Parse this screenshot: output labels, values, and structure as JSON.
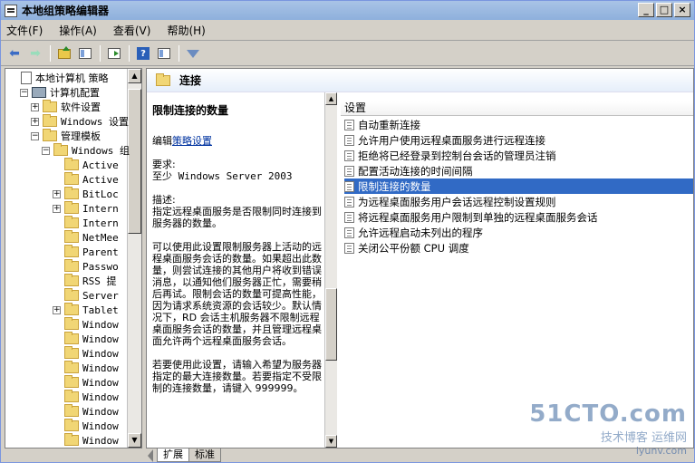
{
  "window": {
    "title": "本地组策略编辑器",
    "min": "_",
    "max": "□",
    "close": "×"
  },
  "menu": [
    "文件(F)",
    "操作(A)",
    "查看(V)",
    "帮助(H)"
  ],
  "tree": [
    {
      "label": "本地计算机 策略",
      "level": 0,
      "exp": "",
      "icon": "doc",
      "cn": true
    },
    {
      "label": "计算机配置",
      "level": 1,
      "exp": "−",
      "icon": "pc",
      "cn": true
    },
    {
      "label": "软件设置",
      "level": 2,
      "exp": "+",
      "icon": "folder",
      "cn": true
    },
    {
      "label": "Windows 设置",
      "level": 2,
      "exp": "+",
      "icon": "folder",
      "cn": false
    },
    {
      "label": "管理模板",
      "level": 2,
      "exp": "−",
      "icon": "folder",
      "cn": true
    },
    {
      "label": "Windows 组",
      "level": 3,
      "exp": "−",
      "icon": "folder",
      "cn": false
    },
    {
      "label": "Active",
      "level": 4,
      "exp": "",
      "icon": "folder",
      "cn": false
    },
    {
      "label": "Active",
      "level": 4,
      "exp": "",
      "icon": "folder",
      "cn": false
    },
    {
      "label": "BitLoc",
      "level": 4,
      "exp": "+",
      "icon": "folder",
      "cn": false
    },
    {
      "label": "Intern",
      "level": 4,
      "exp": "+",
      "icon": "folder",
      "cn": false
    },
    {
      "label": "Intern",
      "level": 4,
      "exp": "",
      "icon": "folder",
      "cn": false
    },
    {
      "label": "NetMee",
      "level": 4,
      "exp": "",
      "icon": "folder",
      "cn": false
    },
    {
      "label": "Parent",
      "level": 4,
      "exp": "",
      "icon": "folder",
      "cn": false
    },
    {
      "label": "Passwo",
      "level": 4,
      "exp": "",
      "icon": "folder",
      "cn": false
    },
    {
      "label": "RSS 提",
      "level": 4,
      "exp": "",
      "icon": "folder",
      "cn": false
    },
    {
      "label": "Server",
      "level": 4,
      "exp": "",
      "icon": "folder",
      "cn": false
    },
    {
      "label": "Tablet",
      "level": 4,
      "exp": "+",
      "icon": "folder",
      "cn": false
    },
    {
      "label": "Window",
      "level": 4,
      "exp": "",
      "icon": "folder",
      "cn": false
    },
    {
      "label": "Window",
      "level": 4,
      "exp": "",
      "icon": "folder",
      "cn": false
    },
    {
      "label": "Window",
      "level": 4,
      "exp": "",
      "icon": "folder",
      "cn": false
    },
    {
      "label": "Window",
      "level": 4,
      "exp": "",
      "icon": "folder",
      "cn": false
    },
    {
      "label": "Window",
      "level": 4,
      "exp": "",
      "icon": "folder",
      "cn": false
    },
    {
      "label": "Window",
      "level": 4,
      "exp": "",
      "icon": "folder",
      "cn": false
    },
    {
      "label": "Window",
      "level": 4,
      "exp": "",
      "icon": "folder",
      "cn": false
    },
    {
      "label": "Window",
      "level": 4,
      "exp": "",
      "icon": "folder",
      "cn": false
    },
    {
      "label": "Window",
      "level": 4,
      "exp": "",
      "icon": "folder",
      "cn": false
    }
  ],
  "panel": {
    "title": "连接"
  },
  "description": {
    "heading": "限制连接的数量",
    "edit_prefix": "编辑",
    "edit_link": "策略设置",
    "req_label": "要求:",
    "req_value": "至少 Windows Server 2003",
    "desc_label": "描述:",
    "p1": "指定远程桌面服务是否限制同时连接到服务器的数量。",
    "p2": "可以使用此设置限制服务器上活动的远程桌面服务会话的数量。如果超出此数量，则尝试连接的其他用户将收到错误消息，以通知他们服务器正忙，需要稍后再试。限制会话的数量可提高性能，因为请求系统资源的会话较少。默认情况下，RD 会话主机服务器不限制远程桌面服务会话的数量，并且管理远程桌面允许两个远程桌面服务会话。",
    "p3": "若要使用此设置，请输入希望为服务器指定的最大连接数量。若要指定不受限制的连接数量，请键入 999999。"
  },
  "list": {
    "header": "设置",
    "items": [
      {
        "label": "自动重新连接",
        "selected": false
      },
      {
        "label": "允许用户使用远程桌面服务进行远程连接",
        "selected": false
      },
      {
        "label": "拒绝将已经登录到控制台会话的管理员注销",
        "selected": false
      },
      {
        "label": "配置活动连接的时间间隔",
        "selected": false
      },
      {
        "label": "限制连接的数量",
        "selected": true
      },
      {
        "label": "为远程桌面服务用户会话远程控制设置规则",
        "selected": false
      },
      {
        "label": "将远程桌面服务用户限制到单独的远程桌面服务会话",
        "selected": false
      },
      {
        "label": "允许远程启动未列出的程序",
        "selected": false
      },
      {
        "label": "关闭公平份额 CPU 调度",
        "selected": false
      }
    ]
  },
  "tabs": [
    "扩展",
    "标准"
  ],
  "watermark": {
    "big": "51CTO.com",
    "small": "技术博客 运维网",
    "url": "iyunv.com"
  }
}
